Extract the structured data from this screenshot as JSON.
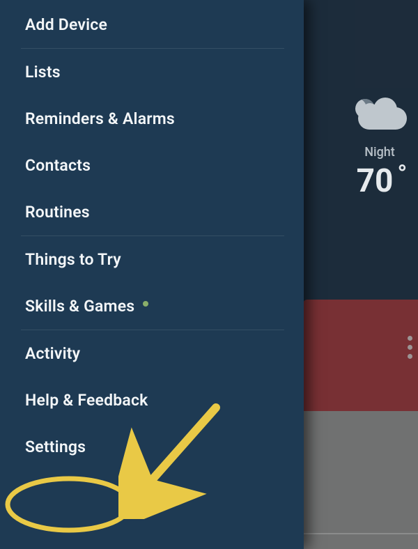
{
  "weather": {
    "condition_label": "Night",
    "temperature": "70"
  },
  "menu": {
    "sections": [
      {
        "items": [
          {
            "label": "Add Device"
          }
        ]
      },
      {
        "items": [
          {
            "label": "Lists"
          },
          {
            "label": "Reminders & Alarms"
          },
          {
            "label": "Contacts"
          },
          {
            "label": "Routines"
          }
        ]
      },
      {
        "items": [
          {
            "label": "Things to Try"
          },
          {
            "label": "Skills & Games",
            "has_notification": true
          }
        ]
      },
      {
        "items": [
          {
            "label": "Activity"
          },
          {
            "label": "Help & Feedback"
          },
          {
            "label": "Settings"
          }
        ]
      }
    ]
  },
  "annotation": {
    "highlight_target": "Settings"
  },
  "colors": {
    "drawer_bg": "#1e3a53",
    "backdrop_bg": "#1a3550",
    "highlight": "#e9c946",
    "card_red": "#b84a51"
  }
}
